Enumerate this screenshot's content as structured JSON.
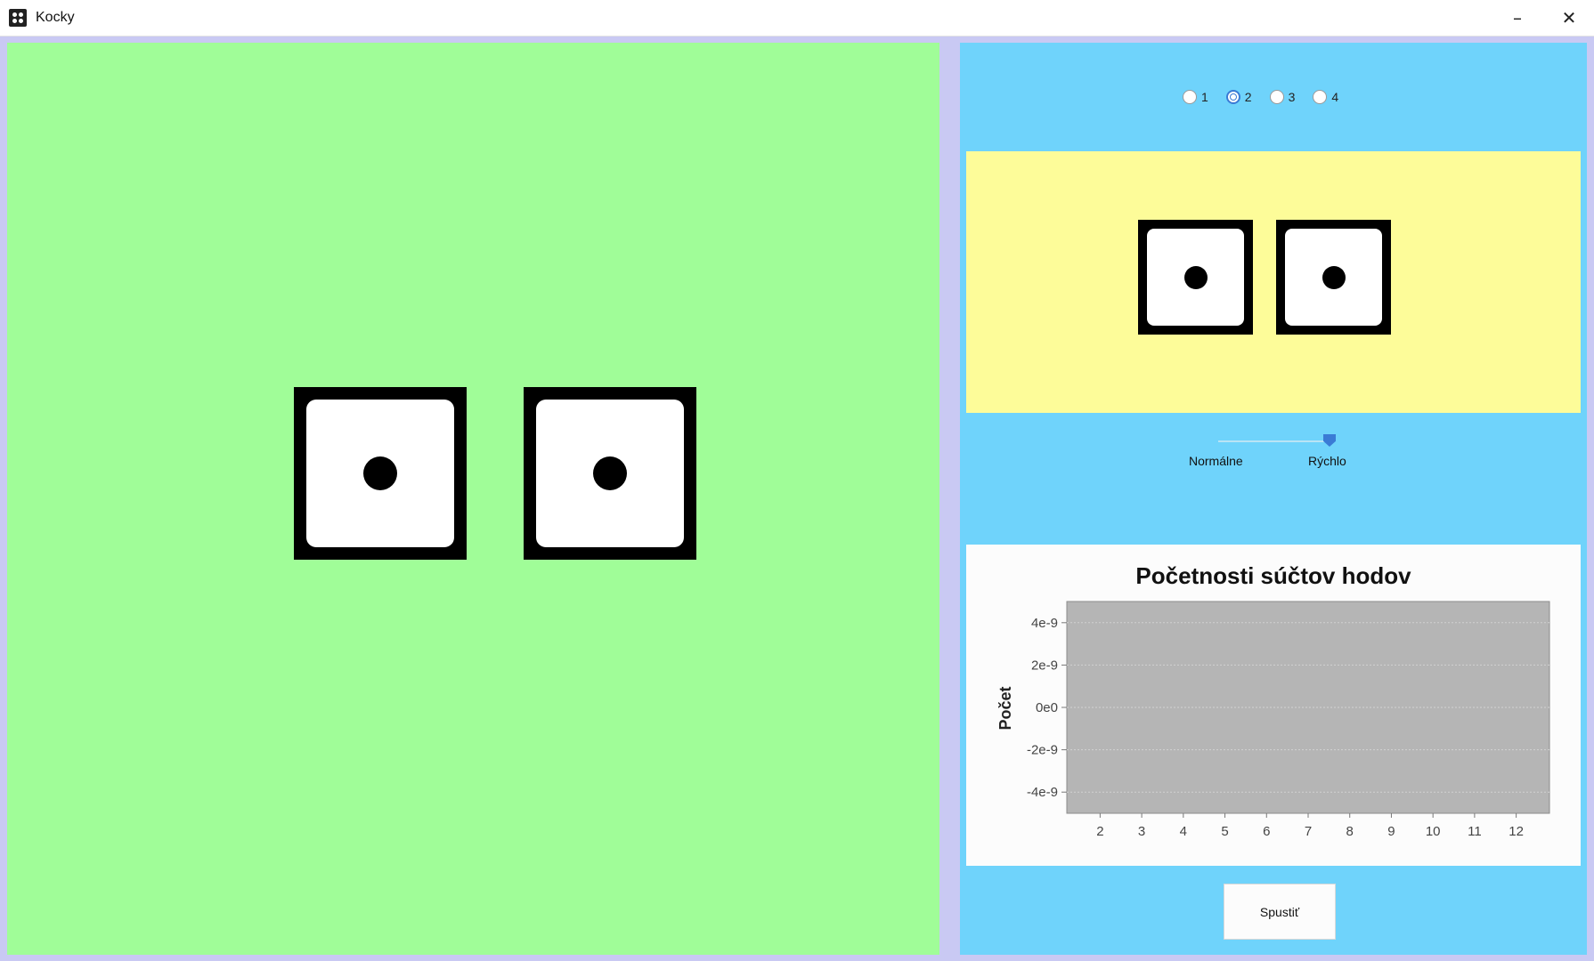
{
  "window": {
    "title": "Kocky",
    "minimize_icon": "minimize-icon",
    "close_icon": "close-icon"
  },
  "dice_count_options": [
    "1",
    "2",
    "3",
    "4"
  ],
  "dice_count_selected": "2",
  "dice_values": [
    1,
    1
  ],
  "speed_slider": {
    "label_left": "Normálne",
    "label_right": "Rýchlo",
    "value": 1.0
  },
  "run_button_label": "Spustiť",
  "chart_data": {
    "type": "bar",
    "title": "Početnosti súčtov hodov",
    "ylabel": "Počet",
    "xlabel": "",
    "categories": [
      "2",
      "3",
      "4",
      "5",
      "6",
      "7",
      "8",
      "9",
      "10",
      "11",
      "12"
    ],
    "values": [
      0,
      0,
      0,
      0,
      0,
      0,
      0,
      0,
      0,
      0,
      0
    ],
    "y_ticks": [
      "4e-9",
      "2e-9",
      "0e0",
      "-2e-9",
      "-4e-9"
    ],
    "ylim": [
      -5e-09,
      5e-09
    ],
    "grid": true,
    "plot_background": "#b5b5b5"
  }
}
